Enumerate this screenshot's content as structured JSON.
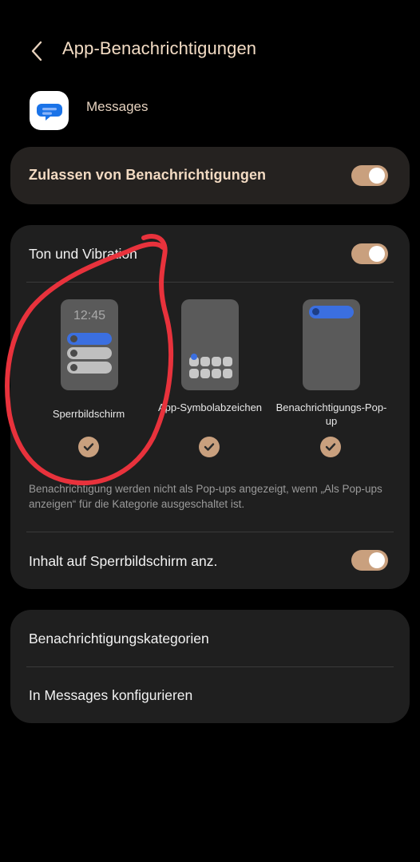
{
  "header": {
    "title": "App-Benachrichtigungen"
  },
  "app": {
    "name": "Messages"
  },
  "allow_notifications": {
    "label": "Zulassen von Benachrichtigungen",
    "enabled": true
  },
  "sound_vibration": {
    "label": "Ton und Vibration",
    "enabled": true
  },
  "styles": [
    {
      "label": "Sperrbildschirm",
      "selected": true,
      "preview_time": "12:45"
    },
    {
      "label": "App-Symbolabzeichen",
      "selected": true
    },
    {
      "label": "Benachrichtigungs-Pop-up",
      "selected": true
    }
  ],
  "info_text": "Benachrichtigung werden nicht als Pop-ups angezeigt, wenn „Als Pop-ups anzeigen“ für die Kategorie ausgeschaltet ist.",
  "lockscreen_content": {
    "label": "Inhalt auf Sperrbildschirm anz.",
    "enabled": true
  },
  "menu": {
    "categories_label": "Benachrichtigungskategorien",
    "configure_label": "In Messages konfigurieren"
  },
  "colors": {
    "accent": "#c9a07e",
    "title_text": "#f3dcc4",
    "card_bg": "#1f1f1f",
    "annotation": "#e8323c",
    "app_icon_blue": "#1a73e8"
  }
}
